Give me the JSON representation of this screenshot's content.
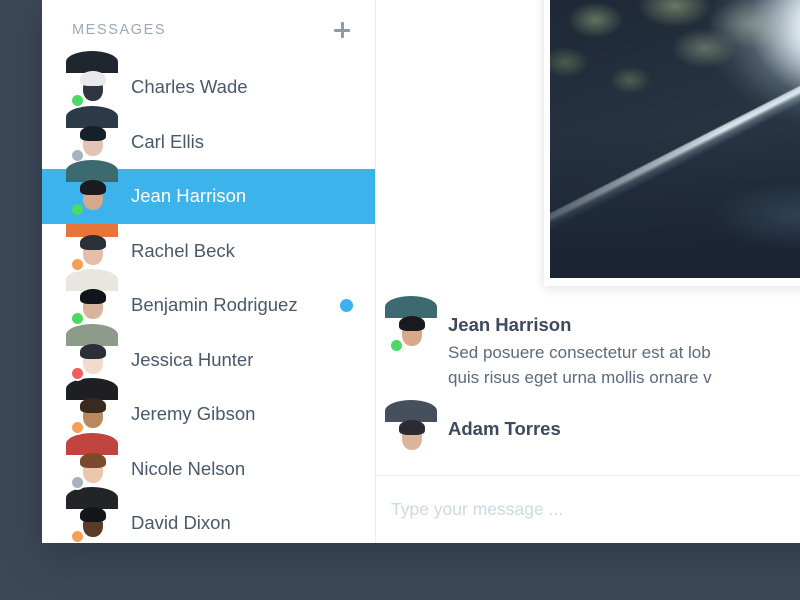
{
  "window": {
    "background_color": "#3c4858",
    "panel_color": "#ffffff"
  },
  "theme": {
    "accent": "#3cb3ea",
    "text_primary": "#49596b",
    "text_muted": "#9aa8b5",
    "status_online": "#4cd964",
    "status_away": "#f5a05a",
    "status_busy": "#f25e5e",
    "status_offline": "#a8b2bd"
  },
  "sidebar": {
    "title": "MESSAGES",
    "add_icon": "plus-icon",
    "conversations": [
      {
        "name": "Charles Wade",
        "status": "online",
        "status_color": "#4cd964",
        "unread": false,
        "selected": false,
        "avatar": {
          "bg": "#c9cdd2",
          "hair": "#e8e9ea",
          "face": "#2e3440",
          "shirt": "#1f2630"
        }
      },
      {
        "name": "Carl Ellis",
        "status": "offline",
        "status_color": "#a8b2bd",
        "unread": false,
        "selected": false,
        "avatar": {
          "bg": "#1f4a3e",
          "hair": "#16202b",
          "face": "#e2c4b4",
          "shirt": "#2b3a46"
        }
      },
      {
        "name": "Jean Harrison",
        "status": "online",
        "status_color": "#4cd964",
        "unread": false,
        "selected": true,
        "avatar": {
          "bg": "#2c4b52",
          "hair": "#1a1a1f",
          "face": "#d8a88c",
          "shirt": "#3d6a70"
        }
      },
      {
        "name": "Rachel Beck",
        "status": "away",
        "status_color": "#f5a05a",
        "unread": false,
        "selected": false,
        "avatar": {
          "bg": "#9ba3a8",
          "hair": "#2a2f38",
          "face": "#e6bda8",
          "shirt": "#e8743a"
        }
      },
      {
        "name": "Benjamin Rodriguez",
        "status": "online",
        "status_color": "#4cd964",
        "unread": true,
        "selected": false,
        "avatar": {
          "bg": "#1b2430",
          "hair": "#10151c",
          "face": "#d9b49c",
          "shirt": "#e9e6df"
        }
      },
      {
        "name": "Jessica Hunter",
        "status": "busy",
        "status_color": "#f25e5e",
        "unread": false,
        "selected": false,
        "avatar": {
          "bg": "#7e8a93",
          "hair": "#2b2f3a",
          "face": "#f0dbcd",
          "shirt": "#8d9c8a"
        }
      },
      {
        "name": "Jeremy Gibson",
        "status": "away",
        "status_color": "#f5a05a",
        "unread": false,
        "selected": false,
        "avatar": {
          "bg": "#e0ac54",
          "hair": "#3a2a1e",
          "face": "#b98a60",
          "shirt": "#1d1f23"
        }
      },
      {
        "name": "Nicole Nelson",
        "status": "offline",
        "status_color": "#a8b2bd",
        "unread": false,
        "selected": false,
        "avatar": {
          "bg": "#3e4a52",
          "hair": "#7a4a2c",
          "face": "#eac7ad",
          "shirt": "#c2443e"
        }
      },
      {
        "name": "David Dixon",
        "status": "away",
        "status_color": "#f5a05a",
        "unread": false,
        "selected": false,
        "avatar": {
          "bg": "#d6d8da",
          "hair": "#15161a",
          "face": "#5c3a2a",
          "shirt": "#222428"
        }
      }
    ]
  },
  "conversation": {
    "attachment": {
      "name": "attachment-photo",
      "description": "Dark forest road at dusk with mist and bright sky"
    },
    "messages": [
      {
        "author": "Jean Harrison",
        "status": "online",
        "status_color": "#4cd964",
        "lines": [
          "Sed posuere consectetur est at lob",
          "quis risus eget urna mollis ornare v"
        ],
        "avatar": {
          "bg": "#2c4b52",
          "hair": "#1a1a1f",
          "face": "#d8a88c",
          "shirt": "#3d6a70"
        }
      },
      {
        "author": "Adam Torres",
        "status": "none",
        "status_color": "#a8b2bd",
        "lines": [],
        "avatar": {
          "bg": "#b7a79c",
          "hair": "#2a2b33",
          "face": "#dbb49c",
          "shirt": "#46505c"
        }
      }
    ],
    "composer": {
      "placeholder": "Type your message ...",
      "value": ""
    }
  }
}
